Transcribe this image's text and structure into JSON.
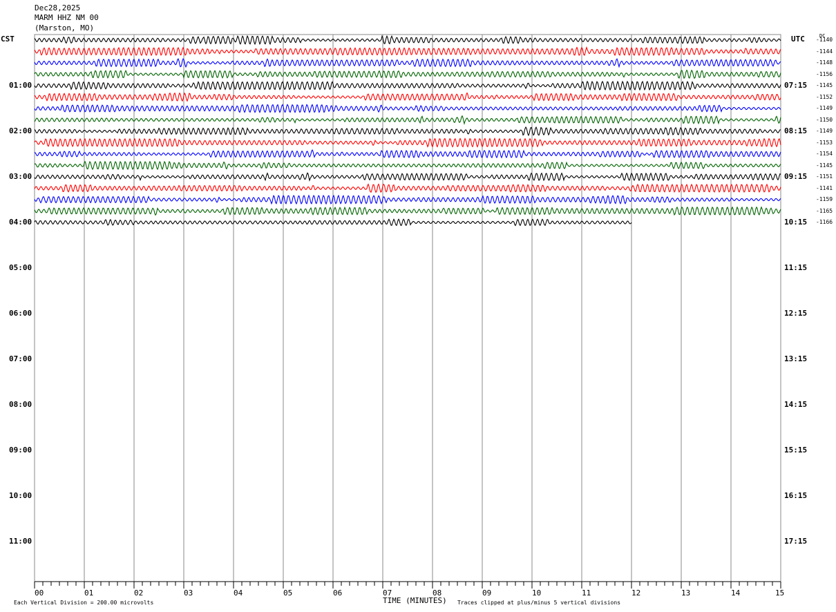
{
  "header": {
    "date": "Dec28,2025",
    "station": "MARM HHZ NM 00",
    "location": "(Marston, MO)"
  },
  "left_zone": "CST",
  "right_zone": "UTC",
  "dc_label": "DC",
  "footer": {
    "scale_note": "Each Vertical Division =  200.00 microvolts",
    "xlabel": "TIME (MINUTES)",
    "clip_note": "Traces clipped at plus/minus 5 vertical divisions"
  },
  "chart_data": {
    "type": "line",
    "xlabel": "TIME (MINUTES)",
    "xlim": [
      0,
      15
    ],
    "x_ticks": [
      "00",
      "01",
      "02",
      "03",
      "04",
      "05",
      "06",
      "07",
      "08",
      "09",
      "10",
      "11",
      "12",
      "13",
      "14",
      "15"
    ],
    "grid": true,
    "rows_per_hour": 4,
    "trace_colors": [
      "#000000",
      "#ff0000",
      "#0000ff",
      "#006400"
    ],
    "left_labels": [
      "01:00",
      "02:00",
      "03:00",
      "04:00",
      "05:00",
      "06:00",
      "07:00",
      "08:00",
      "09:00",
      "10:00",
      "11:00"
    ],
    "right_labels": [
      "07:15",
      "08:15",
      "09:15",
      "10:15",
      "11:15",
      "12:15",
      "13:15",
      "14:15",
      "15:15",
      "16:15",
      "17:15"
    ],
    "dc_offsets": [
      "-1140",
      "-1144",
      "-1148",
      "-1156",
      "-1145",
      "-1152",
      "-1149",
      "-1150",
      "-1149",
      "-1153",
      "-1154",
      "-1145",
      "-1151",
      "-1141",
      "-1159",
      "-1165",
      "-1166"
    ],
    "last_trace_end_minute": 12
  }
}
